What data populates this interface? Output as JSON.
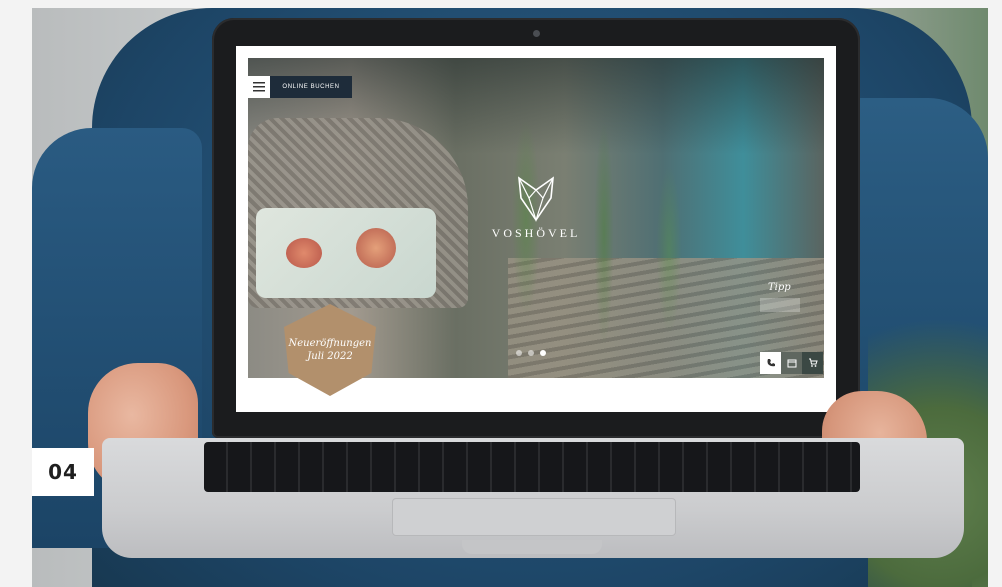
{
  "photo": {
    "label": "04"
  },
  "website": {
    "menu_icon": "hamburger-icon",
    "online_button": "ONLINE BUCHEN",
    "logo_name": "VOSHÖVEL",
    "tipp_text": "Tipp",
    "badge_text": "Neueröffnungen\nJuli 2022",
    "slider_dots": [
      false,
      false,
      true
    ],
    "actions": [
      {
        "name": "phone",
        "icon": "phone-icon"
      },
      {
        "name": "calendar",
        "icon": "calendar-icon"
      },
      {
        "name": "cart",
        "icon": "cart-icon"
      }
    ]
  }
}
